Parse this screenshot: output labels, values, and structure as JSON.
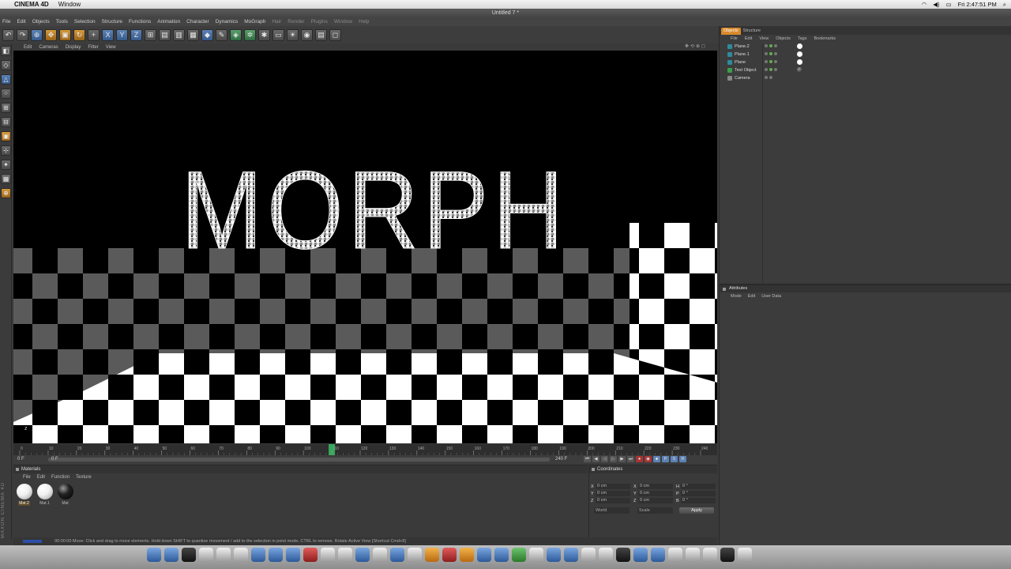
{
  "mac_menubar": {
    "app_name": "CINEMA 4D",
    "menus": [
      "Window"
    ],
    "clock": "Fri 2:47:51 PM"
  },
  "window": {
    "title": "Untitled 7 *"
  },
  "c4d_menu": [
    "File",
    "Edit",
    "Objects",
    "Tools",
    "Selection",
    "Structure",
    "Functions",
    "Animation",
    "Character",
    "Dynamics",
    "MoGraph",
    "Hair",
    "Render",
    "Plugins",
    "Window",
    "Help"
  ],
  "viewport": {
    "menu": [
      "Edit",
      "Cameras",
      "Display",
      "Filter",
      "View"
    ],
    "scene_text": "MORPH",
    "colors": {
      "checker_light": "#ffffff",
      "checker_dark": "#000000",
      "checker_grey": "#5a5a5a",
      "background": "#000000"
    }
  },
  "timeline": {
    "ticks": [
      "0",
      "10",
      "20",
      "30",
      "40",
      "50",
      "60",
      "70",
      "80",
      "90",
      "100",
      "110",
      "120",
      "130",
      "140",
      "150",
      "160",
      "170",
      "180",
      "190",
      "200",
      "210",
      "220",
      "230",
      "240"
    ],
    "current_frame": "0 F",
    "start_frame": "0 F",
    "end_frame_a": "240 F",
    "end_frame_b": "240 F",
    "playhead_color": "#3fc36a"
  },
  "materials": {
    "title": "Materials",
    "menu": [
      "File",
      "Edit",
      "Function",
      "Texture"
    ],
    "items": [
      {
        "label": "Mat.2",
        "style": "white",
        "selected": true
      },
      {
        "label": "Mat.1",
        "style": "white",
        "selected": false
      },
      {
        "label": "Mat",
        "style": "black",
        "selected": false
      }
    ]
  },
  "coordinates": {
    "title": "Coordinates",
    "rows": [
      {
        "a": "X",
        "av": "0 cm",
        "b": "X",
        "bv": "0 cm",
        "c": "H",
        "cv": "0 °"
      },
      {
        "a": "Y",
        "av": "0 cm",
        "b": "Y",
        "bv": "0 cm",
        "c": "P",
        "cv": "0 °"
      },
      {
        "a": "Z",
        "av": "0 cm",
        "b": "Z",
        "bv": "0 cm",
        "c": "B",
        "cv": "0 °"
      }
    ],
    "mode_world": "World",
    "mode_scale": "Scale",
    "apply": "Apply"
  },
  "status": {
    "text": "00:00:00  Move: Click and drag to move elements. Hold down SHIFT to quantize movement / add to the selection in point mode, CTRL to remove.   Rotate Active View [Shortcut Cmd+8]"
  },
  "objects_manager": {
    "tabs": [
      "Objects",
      "Structure"
    ],
    "menu": [
      "File",
      "Edit",
      "View",
      "Objects",
      "Tags",
      "Bookmarks"
    ],
    "objects": [
      {
        "name": "Plane.2",
        "type": "plane",
        "tag": "white"
      },
      {
        "name": "Plane.1",
        "type": "plane",
        "tag": "white"
      },
      {
        "name": "Plane",
        "type": "plane",
        "tag": "white"
      },
      {
        "name": "Text Object",
        "type": "text",
        "tag": "dark"
      },
      {
        "name": "Camera",
        "type": "camera",
        "tag": ""
      }
    ]
  },
  "attributes_manager": {
    "title": "Attributes",
    "menu": [
      "Mode",
      "Edit",
      "User Data"
    ]
  },
  "side_logo": "MAXON CINEMA 4D"
}
